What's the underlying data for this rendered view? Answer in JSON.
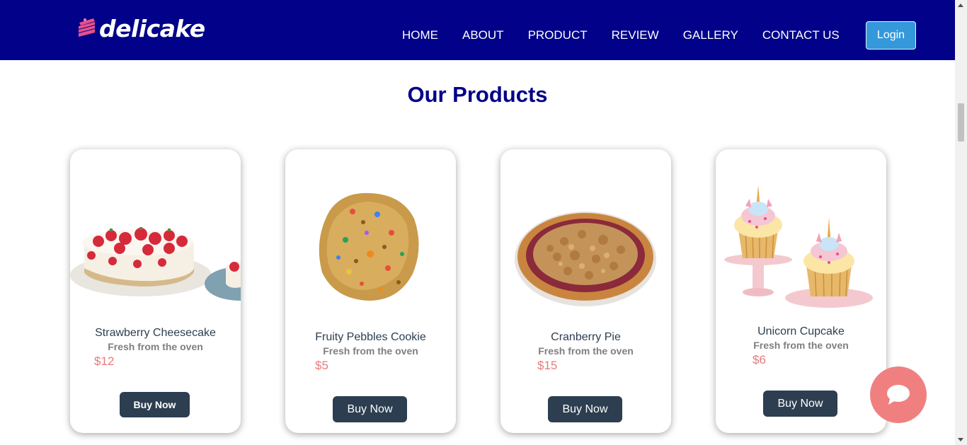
{
  "brand": {
    "name": "delicake",
    "logo_icon": "cake-slice-icon",
    "accent": "#010189"
  },
  "nav": {
    "items": [
      "HOME",
      "ABOUT",
      "PRODUCT",
      "REVIEW",
      "GALLERY",
      "CONTACT US"
    ],
    "login_label": "Login"
  },
  "section": {
    "title": "Our Products"
  },
  "products": [
    {
      "name": "Strawberry Cheesecake",
      "subtitle": "Fresh from the oven",
      "price": "$12",
      "button": "Buy Now",
      "image": "strawberry-cheesecake"
    },
    {
      "name": "Fruity Pebbles Cookie",
      "subtitle": "Fresh from the oven",
      "price": "$5",
      "button": "Buy Now",
      "image": "fruity-cookie"
    },
    {
      "name": "Cranberry Pie",
      "subtitle": "Fresh from the oven",
      "price": "$15",
      "button": "Buy Now",
      "image": "cranberry-pie"
    },
    {
      "name": "Unicorn Cupcake",
      "subtitle": "Fresh from the oven",
      "price": "$6",
      "button": "Buy Now",
      "image": "unicorn-cupcakes"
    }
  ],
  "chat": {
    "icon": "chat-bubble-icon",
    "color": "#f08080"
  },
  "colors": {
    "button": "#2c3e50",
    "price": "#e87b7b",
    "login": "#3498db"
  }
}
